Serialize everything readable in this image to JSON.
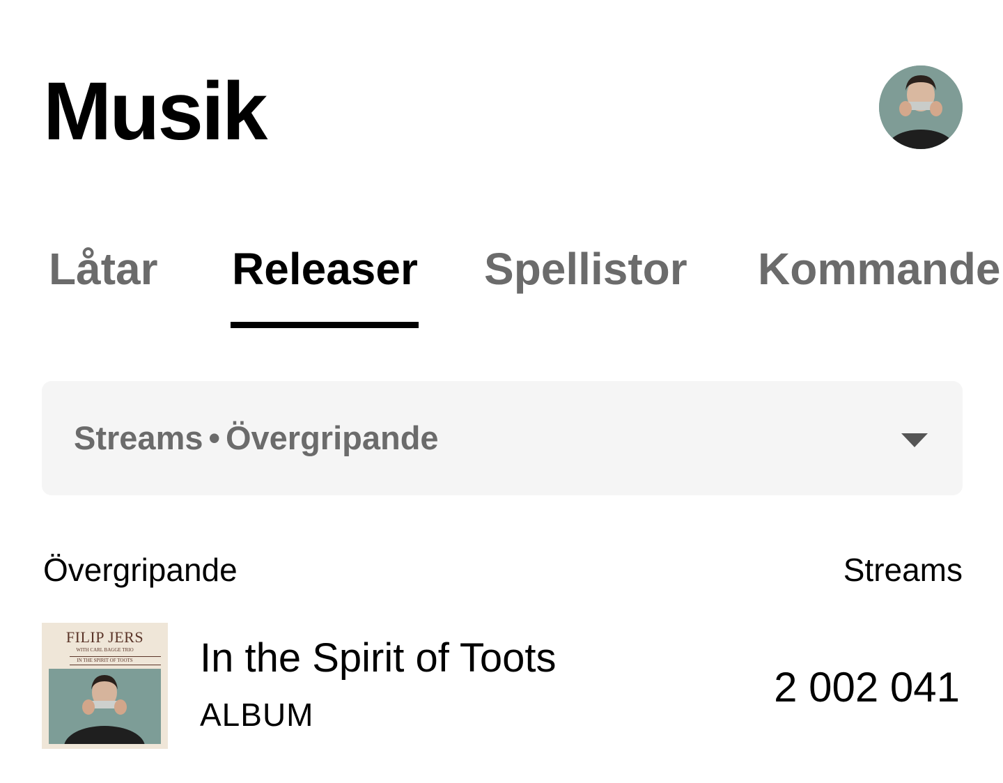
{
  "header": {
    "title": "Musik",
    "avatar_icon": "profile-avatar"
  },
  "tabs": [
    {
      "label": "Låtar",
      "active": false
    },
    {
      "label": "Releaser",
      "active": true
    },
    {
      "label": "Spellistor",
      "active": false
    },
    {
      "label": "Kommande",
      "active": false
    }
  ],
  "filter": {
    "metric": "Streams",
    "separator": "•",
    "scope": "Övergripande",
    "icon": "chevron-down-icon"
  },
  "list": {
    "left_header": "Övergripande",
    "right_header": "Streams",
    "items": [
      {
        "title": "In the Spirit of Toots",
        "type": "ALBUM",
        "streams": "2 002 041",
        "cover": {
          "artist": "FILIP JERS",
          "subtitle": "WITH CARL BAGGE TRIO",
          "album": "IN THE SPIRIT OF TOOTS"
        }
      }
    ]
  },
  "colors": {
    "text_primary": "#000000",
    "text_secondary": "#6b6b6b",
    "filter_bg": "#f5f5f5",
    "active_indicator": "#000000"
  }
}
